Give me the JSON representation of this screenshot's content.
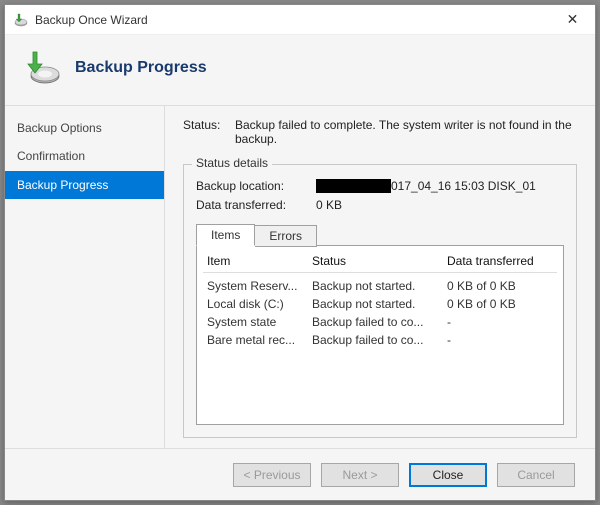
{
  "window": {
    "title": "Backup Once Wizard"
  },
  "header": {
    "title": "Backup Progress"
  },
  "sidebar": {
    "items": [
      {
        "label": "Backup Options",
        "active": false
      },
      {
        "label": "Confirmation",
        "active": false
      },
      {
        "label": "Backup Progress",
        "active": true
      }
    ]
  },
  "content": {
    "status_label": "Status:",
    "status_value": "Backup failed to complete. The system writer is not found in the backup.",
    "group_title": "Status details",
    "rows": {
      "location_label": "Backup location:",
      "location_suffix": "017_04_16 15:03 DISK_01",
      "transferred_label": "Data transferred:",
      "transferred_value": "0 KB"
    },
    "tabs": [
      {
        "label": "Items",
        "active": true
      },
      {
        "label": "Errors",
        "active": false
      }
    ],
    "grid": {
      "headers": {
        "item": "Item",
        "status": "Status",
        "transferred": "Data transferred"
      },
      "rows": [
        {
          "item": "System Reserv...",
          "status": "Backup not started.",
          "transferred": "0 KB of 0 KB"
        },
        {
          "item": "Local disk (C:)",
          "status": "Backup not started.",
          "transferred": "0 KB of 0 KB"
        },
        {
          "item": "System state",
          "status": "Backup failed to co...",
          "transferred": "-"
        },
        {
          "item": "Bare metal rec...",
          "status": "Backup failed to co...",
          "transferred": "-"
        }
      ]
    }
  },
  "footer": {
    "previous": "< Previous",
    "next": "Next >",
    "close": "Close",
    "cancel": "Cancel"
  }
}
